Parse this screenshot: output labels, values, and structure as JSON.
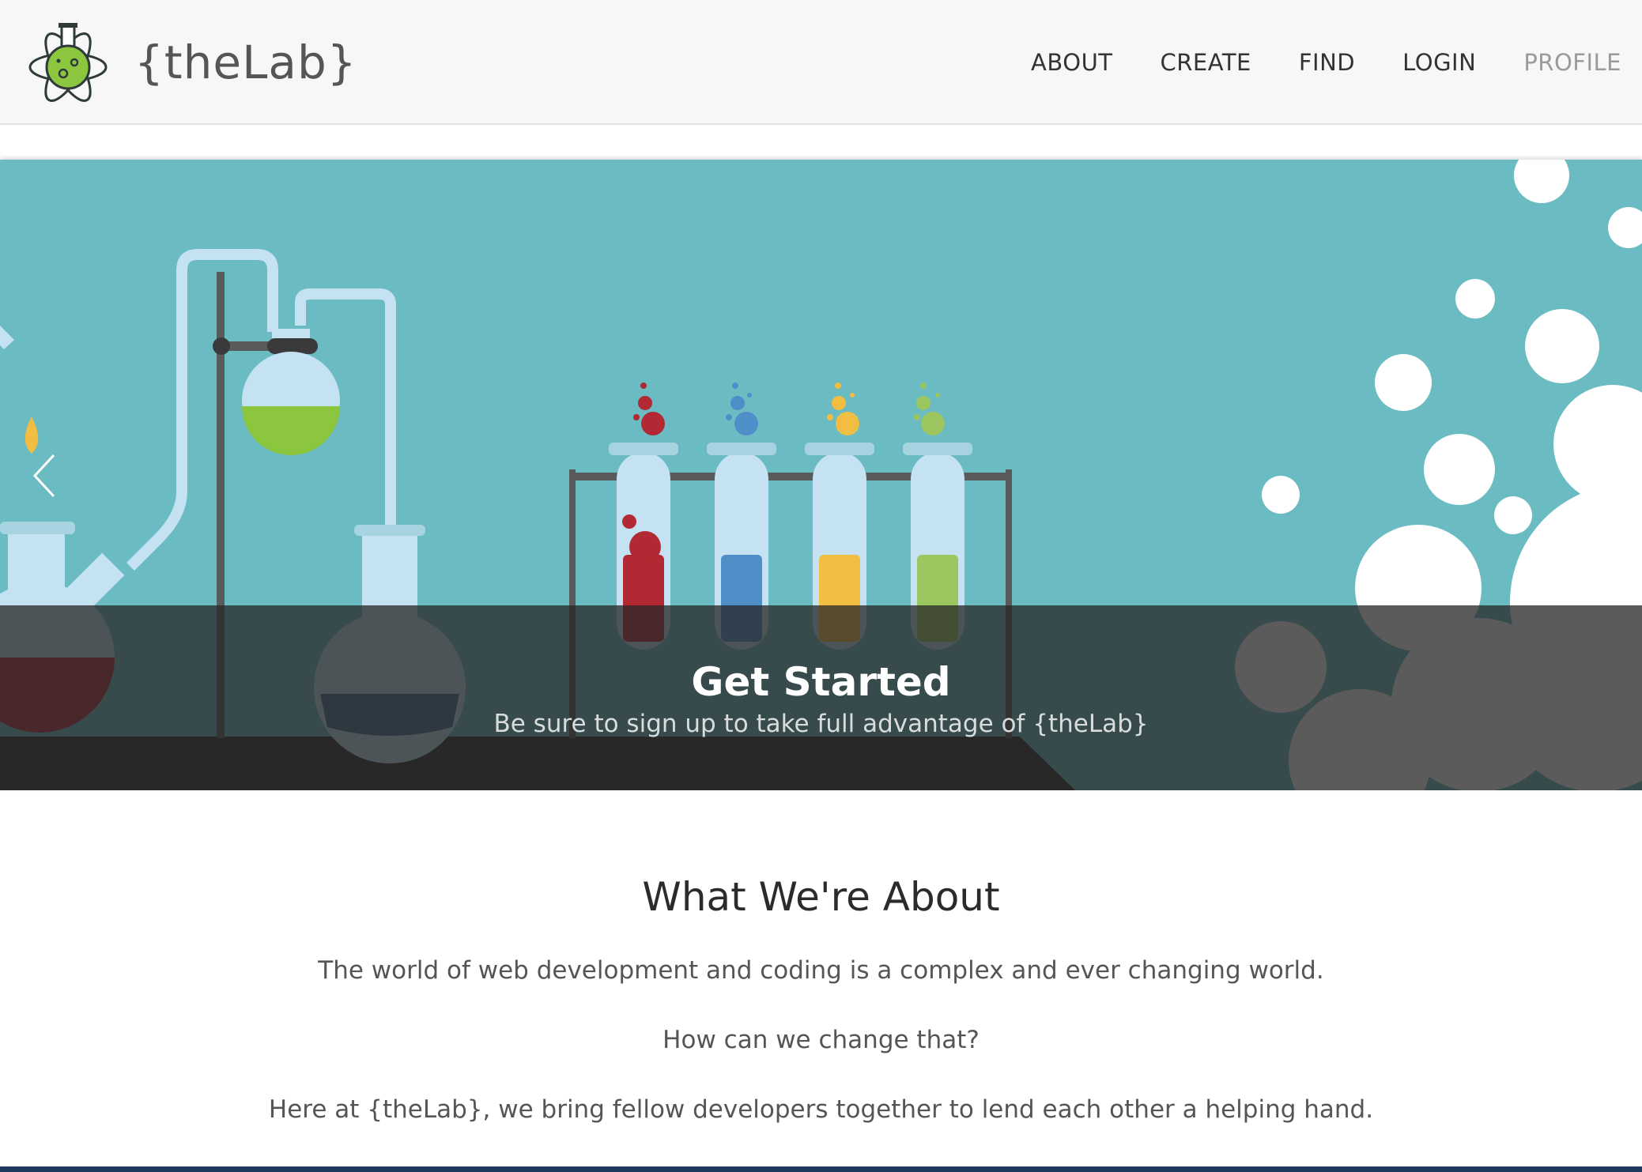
{
  "brand": {
    "name": "{theLab}",
    "logo_icon": "flask-atom-logo-icon"
  },
  "nav": {
    "items": [
      {
        "label": "ABOUT"
      },
      {
        "label": "CREATE"
      },
      {
        "label": "FIND"
      },
      {
        "label": "LOGIN"
      },
      {
        "label": "PROFILE"
      }
    ]
  },
  "carousel": {
    "caption_title": "Get Started",
    "caption_text": "Be sure to sign up to take full advantage of {theLab}",
    "prev_icon": "chevron-left-icon"
  },
  "about": {
    "title": "What We're About",
    "paragraphs": [
      "The world of web development and coding is a complex and ever changing world.",
      "How can we change that?",
      "Here at {theLab}, we bring fellow developers together to lend each other a helping hand."
    ]
  },
  "colors": {
    "navbar_bg": "#f7f7f7",
    "carousel_bg": "#6abbc2",
    "caption_band": "#282828",
    "logo_green": "#8cc63f"
  }
}
